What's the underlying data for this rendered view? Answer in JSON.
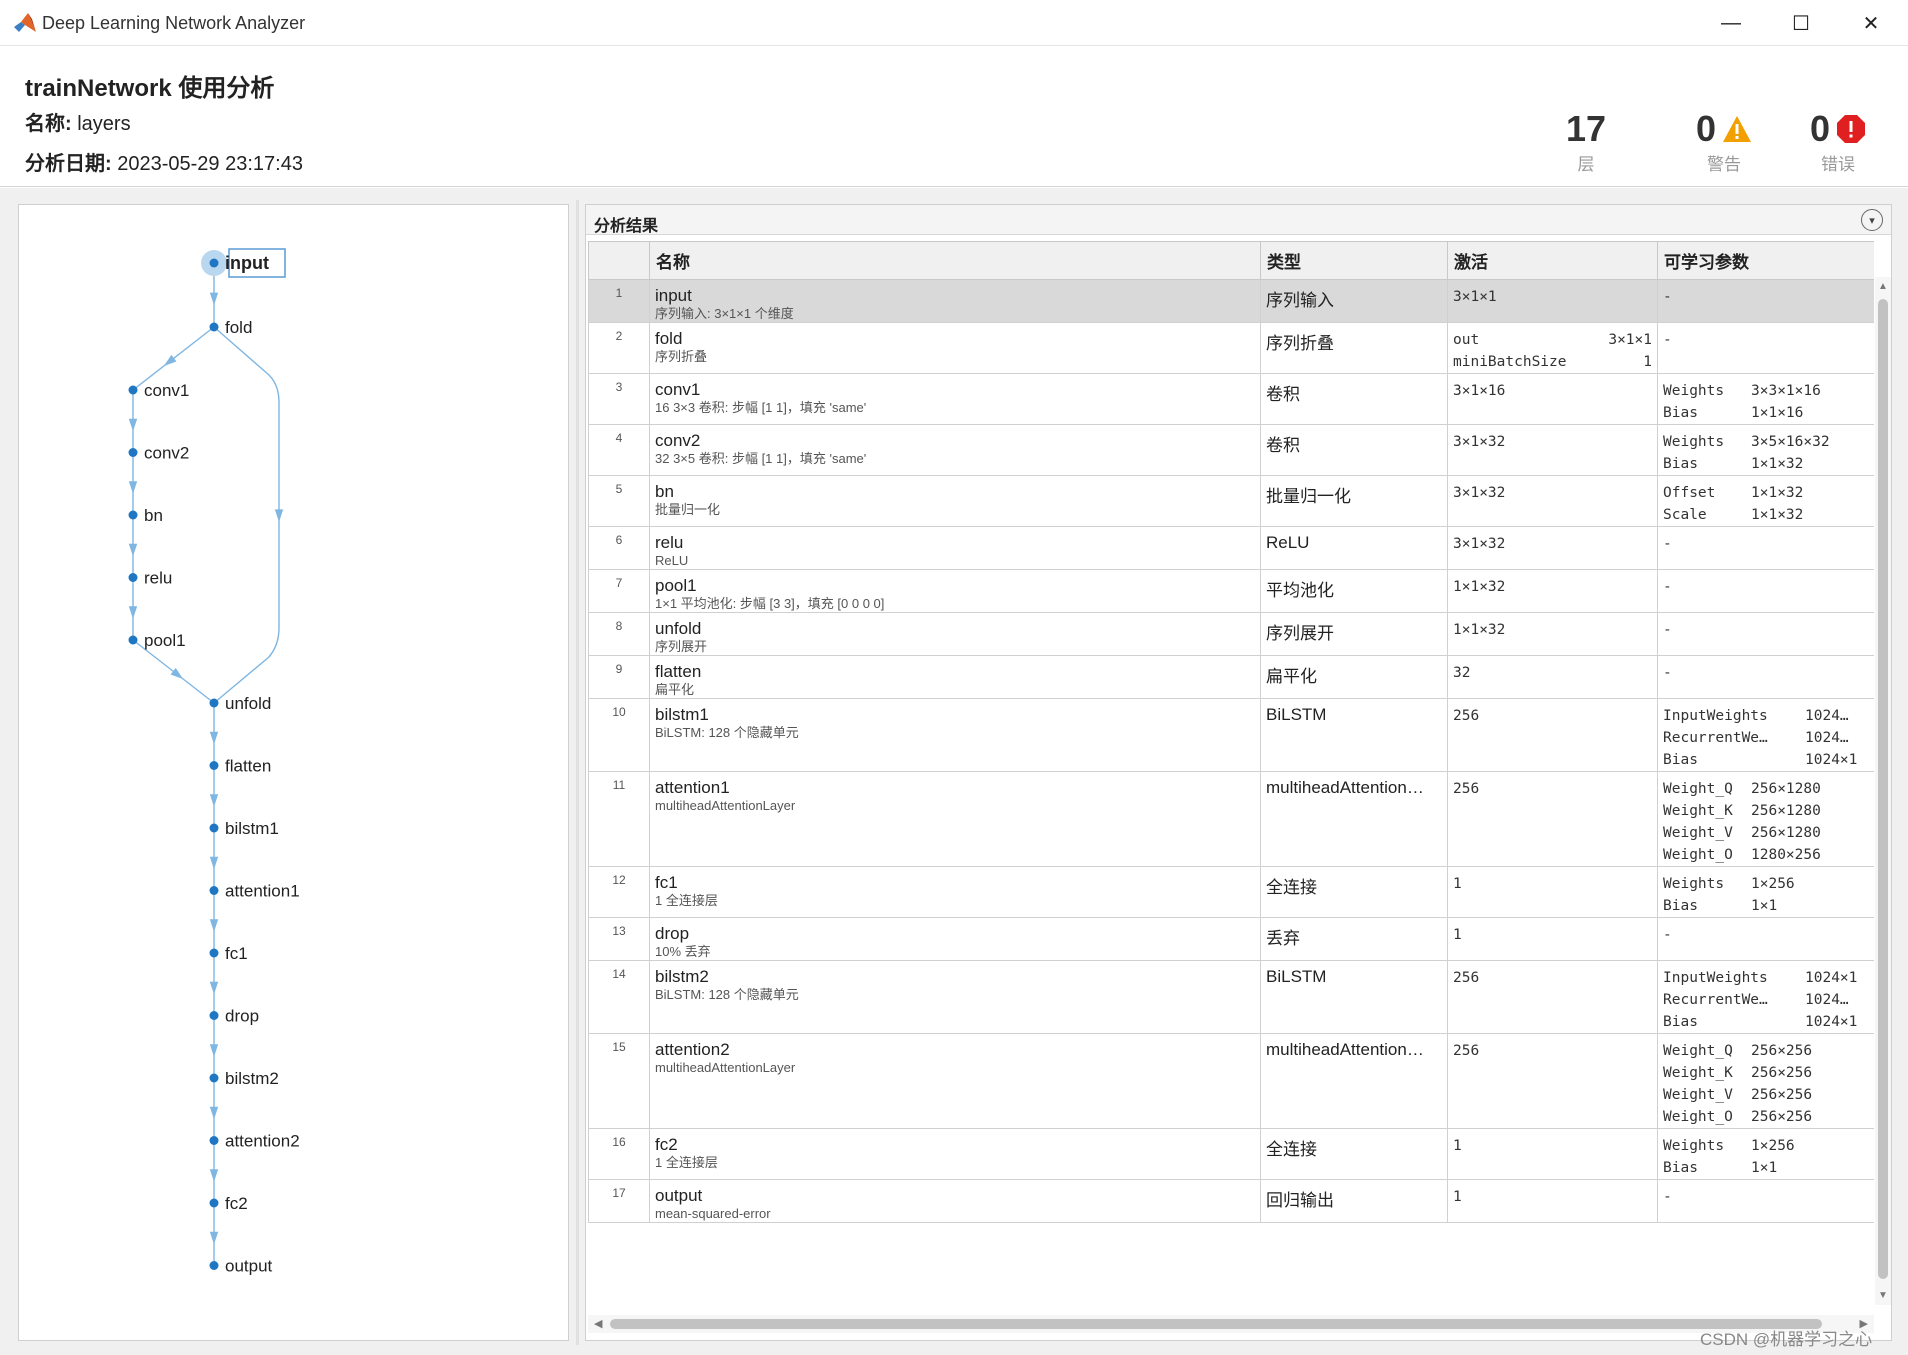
{
  "window": {
    "title": "Deep Learning Network Analyzer",
    "min_symbol": "—",
    "max_symbol": "☐",
    "close_symbol": "✕"
  },
  "header": {
    "title": "trainNetwork 使用分析",
    "name_label": "名称:",
    "name_value": "layers",
    "date_label": "分析日期:",
    "date_value": "2023-05-29 23:17:43"
  },
  "stats": {
    "layers": {
      "value": "17",
      "label": "层"
    },
    "warnings": {
      "value": "0",
      "label": "警告"
    },
    "errors": {
      "value": "0",
      "label": "错误"
    }
  },
  "colors": {
    "node": "#1f77c4",
    "edge": "#7fb6e2",
    "warning": "#f2a000",
    "error": "#e02020"
  },
  "results": {
    "title": "分析结果",
    "columns": [
      "名称",
      "类型",
      "激活",
      "可学习参数"
    ],
    "rows": [
      {
        "idx": "1",
        "name": "input",
        "desc": "序列输入: 3×1×1 个维度",
        "type": "序列输入",
        "act": [
          [
            "3×1×1",
            ""
          ]
        ],
        "params": [
          [
            "-",
            ""
          ]
        ]
      },
      {
        "idx": "2",
        "name": "fold",
        "desc": "序列折叠",
        "type": "序列折叠",
        "act": [
          [
            "out",
            "3×1×1"
          ],
          [
            "miniBatchSize",
            "1"
          ]
        ],
        "params": [
          [
            "-",
            ""
          ]
        ]
      },
      {
        "idx": "3",
        "name": "conv1",
        "desc": "16 3×3 卷积: 步幅 [1 1]，填充 'same'",
        "type": "卷积",
        "act": [
          [
            "3×1×16",
            ""
          ]
        ],
        "params": [
          [
            "Weights",
            "3×3×1×16"
          ],
          [
            "Bias",
            "1×1×16"
          ]
        ]
      },
      {
        "idx": "4",
        "name": "conv2",
        "desc": "32 3×5 卷积: 步幅 [1 1]，填充 'same'",
        "type": "卷积",
        "act": [
          [
            "3×1×32",
            ""
          ]
        ],
        "params": [
          [
            "Weights",
            "3×5×16×32"
          ],
          [
            "Bias",
            "1×1×32"
          ]
        ]
      },
      {
        "idx": "5",
        "name": "bn",
        "desc": "批量归一化",
        "type": "批量归一化",
        "act": [
          [
            "3×1×32",
            ""
          ]
        ],
        "params": [
          [
            "Offset",
            "1×1×32"
          ],
          [
            "Scale",
            "1×1×32"
          ]
        ]
      },
      {
        "idx": "6",
        "name": "relu",
        "desc": "ReLU",
        "type": "ReLU",
        "act": [
          [
            "3×1×32",
            ""
          ]
        ],
        "params": [
          [
            "-",
            ""
          ]
        ]
      },
      {
        "idx": "7",
        "name": "pool1",
        "desc": "1×1 平均池化: 步幅 [3 3]，填充 [0 0 0 0]",
        "type": "平均池化",
        "act": [
          [
            "1×1×32",
            ""
          ]
        ],
        "params": [
          [
            "-",
            ""
          ]
        ]
      },
      {
        "idx": "8",
        "name": "unfold",
        "desc": "序列展开",
        "type": "序列展开",
        "act": [
          [
            "1×1×32",
            ""
          ]
        ],
        "params": [
          [
            "-",
            ""
          ]
        ]
      },
      {
        "idx": "9",
        "name": "flatten",
        "desc": "扁平化",
        "type": "扁平化",
        "act": [
          [
            "32",
            ""
          ]
        ],
        "params": [
          [
            "-",
            ""
          ]
        ]
      },
      {
        "idx": "10",
        "name": "bilstm1",
        "desc": "BiLSTM: 128 个隐藏单元",
        "type": "BiLSTM",
        "act": [
          [
            "256",
            ""
          ]
        ],
        "params": [
          [
            "InputWeights",
            "1024…"
          ],
          [
            "RecurrentWe…",
            "1024…"
          ],
          [
            "Bias",
            "1024×1"
          ]
        ]
      },
      {
        "idx": "11",
        "name": "attention1",
        "desc": "multiheadAttentionLayer",
        "type": "multiheadAttention…",
        "act": [
          [
            "256",
            ""
          ]
        ],
        "params": [
          [
            "Weight_Q",
            "256×1280"
          ],
          [
            "Weight_K",
            "256×1280"
          ],
          [
            "Weight_V",
            "256×1280"
          ],
          [
            "Weight_O",
            "1280×256"
          ]
        ]
      },
      {
        "idx": "12",
        "name": "fc1",
        "desc": "1 全连接层",
        "type": "全连接",
        "act": [
          [
            "1",
            ""
          ]
        ],
        "params": [
          [
            "Weights",
            "1×256"
          ],
          [
            "Bias",
            "1×1"
          ]
        ]
      },
      {
        "idx": "13",
        "name": "drop",
        "desc": "10% 丢弃",
        "type": "丢弃",
        "act": [
          [
            "1",
            ""
          ]
        ],
        "params": [
          [
            "-",
            ""
          ]
        ]
      },
      {
        "idx": "14",
        "name": "bilstm2",
        "desc": "BiLSTM: 128 个隐藏单元",
        "type": "BiLSTM",
        "act": [
          [
            "256",
            ""
          ]
        ],
        "params": [
          [
            "InputWeights",
            "1024×1"
          ],
          [
            "RecurrentWe…",
            "1024…"
          ],
          [
            "Bias",
            "1024×1"
          ]
        ]
      },
      {
        "idx": "15",
        "name": "attention2",
        "desc": "multiheadAttentionLayer",
        "type": "multiheadAttention…",
        "act": [
          [
            "256",
            ""
          ]
        ],
        "params": [
          [
            "Weight_Q",
            "256×256"
          ],
          [
            "Weight_K",
            "256×256"
          ],
          [
            "Weight_V",
            "256×256"
          ],
          [
            "Weight_O",
            "256×256"
          ]
        ]
      },
      {
        "idx": "16",
        "name": "fc2",
        "desc": "1 全连接层",
        "type": "全连接",
        "act": [
          [
            "1",
            ""
          ]
        ],
        "params": [
          [
            "Weights",
            "1×256"
          ],
          [
            "Bias",
            "1×1"
          ]
        ]
      },
      {
        "idx": "17",
        "name": "output",
        "desc": "mean-squared-error",
        "type": "回归输出",
        "act": [
          [
            "1",
            ""
          ]
        ],
        "params": [
          [
            "-",
            ""
          ]
        ]
      }
    ]
  },
  "graph": {
    "selected": "input",
    "nodes": [
      "input",
      "fold",
      "conv1",
      "conv2",
      "bn",
      "relu",
      "pool1",
      "unfold",
      "flatten",
      "bilstm1",
      "attention1",
      "fc1",
      "drop",
      "bilstm2",
      "attention2",
      "fc2",
      "output"
    ],
    "edges": [
      [
        "input",
        "fold"
      ],
      [
        "fold",
        "conv1"
      ],
      [
        "conv1",
        "conv2"
      ],
      [
        "conv2",
        "bn"
      ],
      [
        "bn",
        "relu"
      ],
      [
        "relu",
        "pool1"
      ],
      [
        "pool1",
        "unfold"
      ],
      [
        "fold",
        "unfold"
      ],
      [
        "unfold",
        "flatten"
      ],
      [
        "flatten",
        "bilstm1"
      ],
      [
        "bilstm1",
        "attention1"
      ],
      [
        "attention1",
        "fc1"
      ],
      [
        "fc1",
        "drop"
      ],
      [
        "drop",
        "bilstm2"
      ],
      [
        "bilstm2",
        "attention2"
      ],
      [
        "attention2",
        "fc2"
      ],
      [
        "fc2",
        "output"
      ]
    ]
  },
  "watermark": "CSDN @机器学习之心"
}
